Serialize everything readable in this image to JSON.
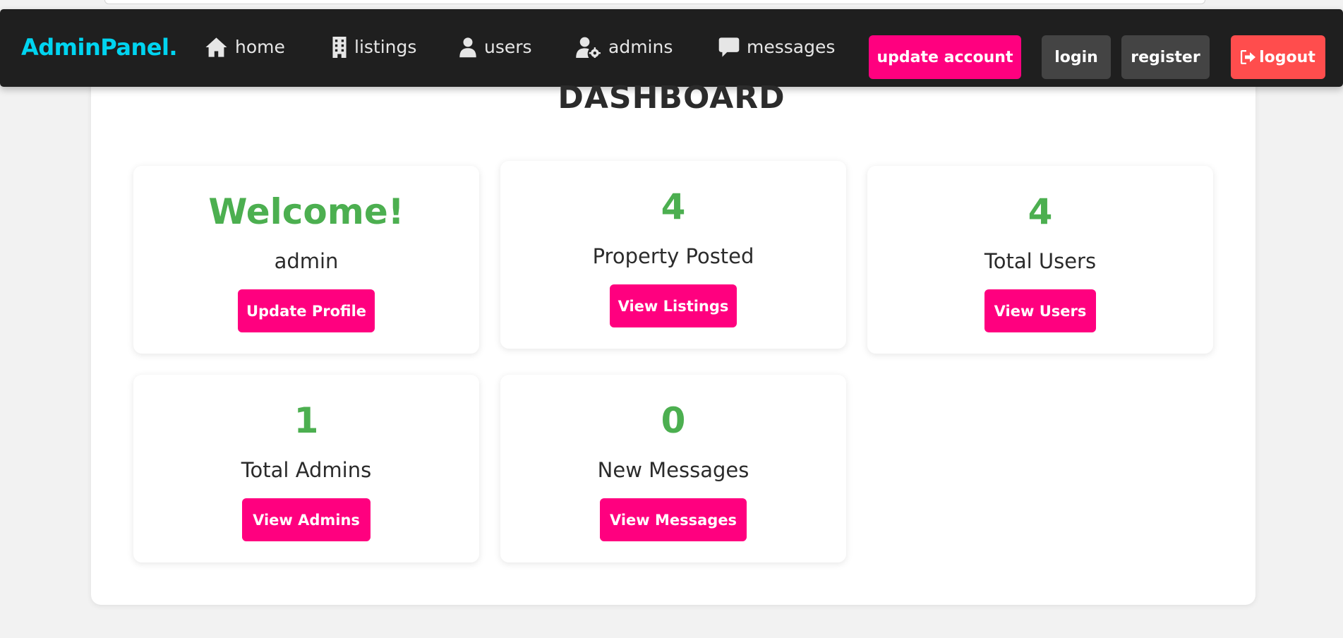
{
  "nav": {
    "logo": "AdminPanel.",
    "links": [
      {
        "label": "home",
        "icon": "home-icon"
      },
      {
        "label": "listings",
        "icon": "building-icon"
      },
      {
        "label": "users",
        "icon": "user-icon"
      },
      {
        "label": "admins",
        "icon": "user-gear-icon"
      },
      {
        "label": "messages",
        "icon": "message-icon"
      }
    ],
    "buttons": {
      "update_account": "update account",
      "login": "login",
      "register": "register",
      "logout": "logout"
    }
  },
  "dashboard": {
    "title": "DASHBOARD",
    "cards": [
      {
        "big": "Welcome!",
        "label": "admin",
        "button": "Update Profile"
      },
      {
        "big": "4",
        "label": "Property Posted",
        "button": "View Listings"
      },
      {
        "big": "4",
        "label": "Total Users",
        "button": "View Users"
      },
      {
        "big": "1",
        "label": "Total Admins",
        "button": "View Admins"
      },
      {
        "big": "0",
        "label": "New Messages",
        "button": "View Messages"
      }
    ]
  },
  "colors": {
    "accent": "#ff007f",
    "logo": "#00d4f0",
    "stat": "#4caf50",
    "logout": "#ff4d4d",
    "navbar": "#1f1f1f"
  }
}
